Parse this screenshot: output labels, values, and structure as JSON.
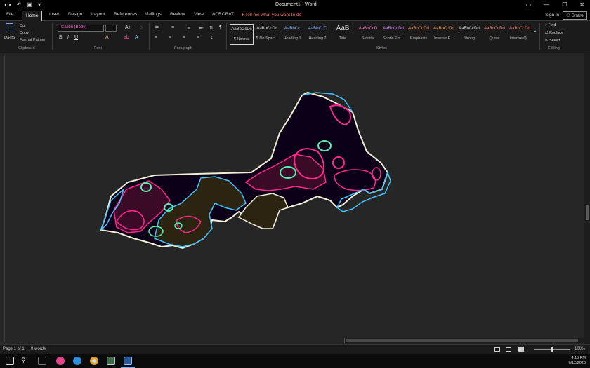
{
  "window": {
    "title": "Document1 - Word",
    "qat_icons": [
      "autosave-icon",
      "undo-icon",
      "redo-icon",
      "customize-icon"
    ],
    "controls": [
      "ribbon-display-icon",
      "minimize-icon",
      "maximize-icon",
      "close-icon"
    ]
  },
  "tabs": {
    "file": "File",
    "home": "Home",
    "insert": "Insert",
    "design": "Design",
    "layout": "Layout",
    "references": "References",
    "mailings": "Mailings",
    "review": "Review",
    "view": "View",
    "acrobat": "ACROBAT",
    "tell_me": "Tell me what you want to do",
    "sign_in": "Sign in",
    "share": "Share"
  },
  "ribbon": {
    "paste": "Paste",
    "cut": "Cut",
    "copy": "Copy",
    "format_painter": "Format Painter",
    "clipboard": "Clipboard",
    "font_name": "Calibri (Body)",
    "font_size": "11",
    "font": "Font",
    "paragraph": "Paragraph",
    "styles_group": "Styles",
    "styles": [
      {
        "sample": "AaBbCcDc",
        "name": "¶ Normal"
      },
      {
        "sample": "AaBbCcDc",
        "name": "¶ No Spac..."
      },
      {
        "sample": "AaBbCc",
        "name": "Heading 1"
      },
      {
        "sample": "AaBbCcC",
        "name": "Heading 2"
      },
      {
        "sample": "AaB",
        "name": "Title"
      },
      {
        "sample": "AaBbCcD",
        "name": "Subtitle"
      },
      {
        "sample": "AaBbCcDd",
        "name": "Subtle Em..."
      },
      {
        "sample": "AaBbCcDd",
        "name": "Emphasis"
      },
      {
        "sample": "AaBbCcDd",
        "name": "Intense E..."
      },
      {
        "sample": "AaBbCcDd",
        "name": "Strong"
      },
      {
        "sample": "AaBbCcDd",
        "name": "Quote"
      },
      {
        "sample": "AaBbCcDd",
        "name": "Intense Q..."
      }
    ],
    "find": "Find",
    "replace": "Replace",
    "select": "Select",
    "editing": "Editing"
  },
  "status": {
    "page": "Page 1 of 1",
    "words": "0 words",
    "zoom": "100%"
  },
  "taskbar": {
    "items": [
      "start-icon",
      "search-icon",
      "task-view-icon",
      "firefox-icon",
      "edge-icon",
      "chrome-icon",
      "photos-icon",
      "word-icon"
    ],
    "time": "4:15 PM",
    "date": "6/12/2020"
  },
  "colors": {
    "map_fill_dark": "#0c0018",
    "map_fill_brown": "#2b2410",
    "map_fill_maroon": "#3a0a26",
    "contour_cyan": "#43c3ff",
    "contour_pink": "#ff2a8f",
    "contour_green": "#56f0b0",
    "outline_white": "#f2f0d8"
  }
}
